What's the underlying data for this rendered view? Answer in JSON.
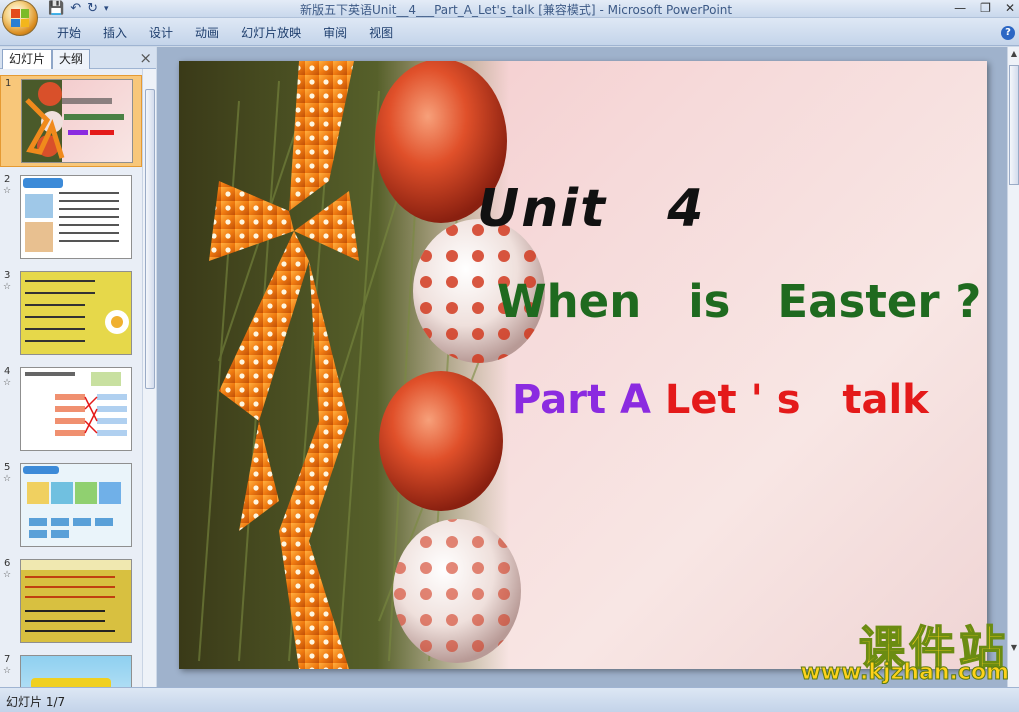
{
  "window": {
    "title": "新版五下英语Unit__4___Part_A_Let's_talk [兼容模式]",
    "app_name": "Microsoft PowerPoint"
  },
  "ribbon": {
    "tabs": [
      "开始",
      "插入",
      "设计",
      "动画",
      "幻灯片放映",
      "审阅",
      "视图"
    ]
  },
  "left_panel": {
    "tabs": [
      "幻灯片",
      "大纲"
    ],
    "close_glyph": "×",
    "slide_numbers": [
      "1",
      "2",
      "3",
      "4",
      "5",
      "6",
      "7"
    ]
  },
  "slide": {
    "title": "Unit   4",
    "subtitle": "When   is   Easter ?",
    "part_a": "Part A",
    "lets_talk": "Let ' s   talk"
  },
  "watermark": {
    "cn": "课件站",
    "url": "www.kjzhan.com"
  },
  "status": {
    "slide_counter": "幻灯片 1/7"
  },
  "colors": {
    "subtitle_green": "#1f6a1f",
    "part_purple": "#8b2be0",
    "talk_red": "#e41a1a",
    "watermark_yellow": "#ffd21a"
  }
}
